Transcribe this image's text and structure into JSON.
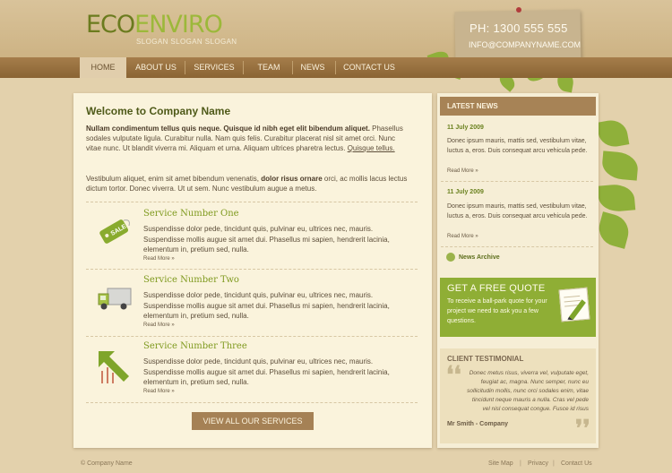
{
  "brand": {
    "logo_part1": "ECO",
    "logo_part2": "ENVIRO",
    "slogan": "SLOGAN SLOGAN SLOGAN",
    "phone": "PH: 1300 555 555",
    "email": "INFO@COMPANYNAME.COM"
  },
  "nav": {
    "items": [
      {
        "label": "HOME"
      },
      {
        "label": "ABOUT US"
      },
      {
        "label": "SERVICES"
      },
      {
        "label": "TEAM"
      },
      {
        "label": "NEWS"
      },
      {
        "label": "CONTACT US"
      }
    ]
  },
  "main": {
    "title": "Welcome to Company Name",
    "intro_bold": "Nullam condimentum tellus quis neque. Quisque id nibh eget elit bibendum aliquet.",
    "intro_text": " Phasellus sodales vulputate ligula. Curabitur nulla. Nam quis felis. Curabitur placerat nisl sit amet orci. Nunc vitae nunc. Ut blandit viverra mi. Aliquam et urna. Aliquam ultrices pharetra lectus.",
    "intro_link": "Quisque tellus.",
    "para2_a": "Vestibulum aliquet, enim sit amet bibendum venenatis, ",
    "para2_bold": "dolor risus ornare",
    "para2_b": " orci, ac mollis lacus lectus dictum tortor. Donec viverra. Ut ut sem. Nunc vestibulum augue a metus.",
    "services": [
      {
        "title": "Service Number One",
        "text": "Suspendisse dolor pede, tincidunt quis, pulvinar eu, ultrices nec, mauris. Suspendisse mollis augue sit amet dui. Phasellus mi sapien, hendrerit lacinia, elementum in, pretium sed, nulla.",
        "more": "Read More »",
        "icon": "sale-tag-icon",
        "tag_text": "SALE"
      },
      {
        "title": "Service Number Two",
        "text": "Suspendisse dolor pede, tincidunt quis, pulvinar eu, ultrices nec, mauris. Suspendisse mollis augue sit amet dui. Phasellus mi sapien, hendrerit lacinia, elementum in, pretium sed, nulla.",
        "more": "Read More »",
        "icon": "truck-icon"
      },
      {
        "title": "Service Number Three",
        "text": "Suspendisse dolor pede, tincidunt quis, pulvinar eu, ultrices nec, mauris. Suspendisse mollis augue sit amet dui. Phasellus mi sapien, hendrerit lacinia, elementum in, pretium sed, nulla.",
        "more": "Read More »",
        "icon": "growth-arrow-icon"
      }
    ],
    "view_all": "VIEW ALL OUR SERVICES"
  },
  "sidebar": {
    "news_heading": "LATEST NEWS",
    "news": [
      {
        "date": "11 July 2009",
        "text": "Donec ipsum mauris, mattis sed, vestibulum vitae, luctus a, eros. Duis consequat arcu vehicula pede.",
        "more": "Read More »"
      },
      {
        "date": "11 July 2009",
        "text": "Donec ipsum mauris, mattis sed, vestibulum vitae, luctus a, eros. Duis consequat arcu vehicula pede.",
        "more": "Read More »"
      }
    ],
    "archive": "News Archive",
    "quote_title": "GET A FREE QUOTE",
    "quote_text": "To receive a ball-park quote for your project we need to ask you a few questions.",
    "testimonial_heading": "CLIENT TESTIMONIAL",
    "testimonial_text": "Donec metus risus, viverra vel, vulputate eget, feugiat ac, magna. Nunc semper, nunc eu sollicitudin mollis, nunc orci sodales enim, vitae tincidunt neque mauris a nulla. Cras vel pede vel nisl consequat congue. Fusce id risus",
    "testimonial_author": "Mr Smith - Company"
  },
  "footer": {
    "copyright": "© Company Name",
    "links": [
      "Site Map",
      "Privacy",
      "Contact Us"
    ]
  },
  "colors": {
    "accent_green": "#8fae35",
    "nav_brown": "#8a6434",
    "paper": "#faf3dc"
  }
}
